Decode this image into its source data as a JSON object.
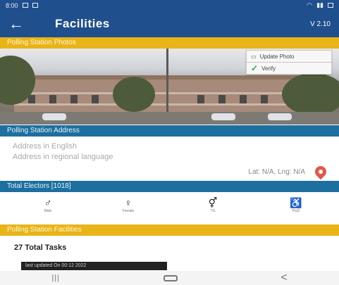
{
  "status_bar": {
    "time": "8:00"
  },
  "app_bar": {
    "back_glyph": "←",
    "title": "Facilities",
    "version": "V 2.10"
  },
  "photo_section": {
    "header": "Polling Station Photos",
    "update_button": "Update Photo",
    "verify_button": "Verify",
    "update_icon": "image-icon",
    "verify_icon": "check-icon"
  },
  "address_section": {
    "header": "Polling Station Address",
    "address_english": "Address in English",
    "address_regional": "Address in regional language",
    "lat_lng": "Lat: N/A, Lng: N/A",
    "map_icon": "map-pin-icon"
  },
  "electors_section": {
    "header": "Total Electors [1018]",
    "items": [
      {
        "icon": "male-icon",
        "glyph": "♂",
        "label": "Male"
      },
      {
        "icon": "female-icon",
        "glyph": "♀",
        "label": "Female"
      },
      {
        "icon": "third-gender-icon",
        "glyph": "⚥",
        "label": "TG"
      },
      {
        "icon": "wheelchair-icon",
        "glyph": "♿",
        "label": "PwD"
      }
    ]
  },
  "facilities_section": {
    "header": "Polling Station Facilities",
    "total_tasks": "27 Total Tasks",
    "last_updated": "last updated On 00:12 2022"
  },
  "nav_bar": {
    "recent": "|||",
    "back": "<"
  },
  "colors": {
    "primary": "#1f4f8c",
    "section_blue": "#1d6f9f",
    "section_yellow": "#e8b417",
    "pin": "#e3574a"
  }
}
